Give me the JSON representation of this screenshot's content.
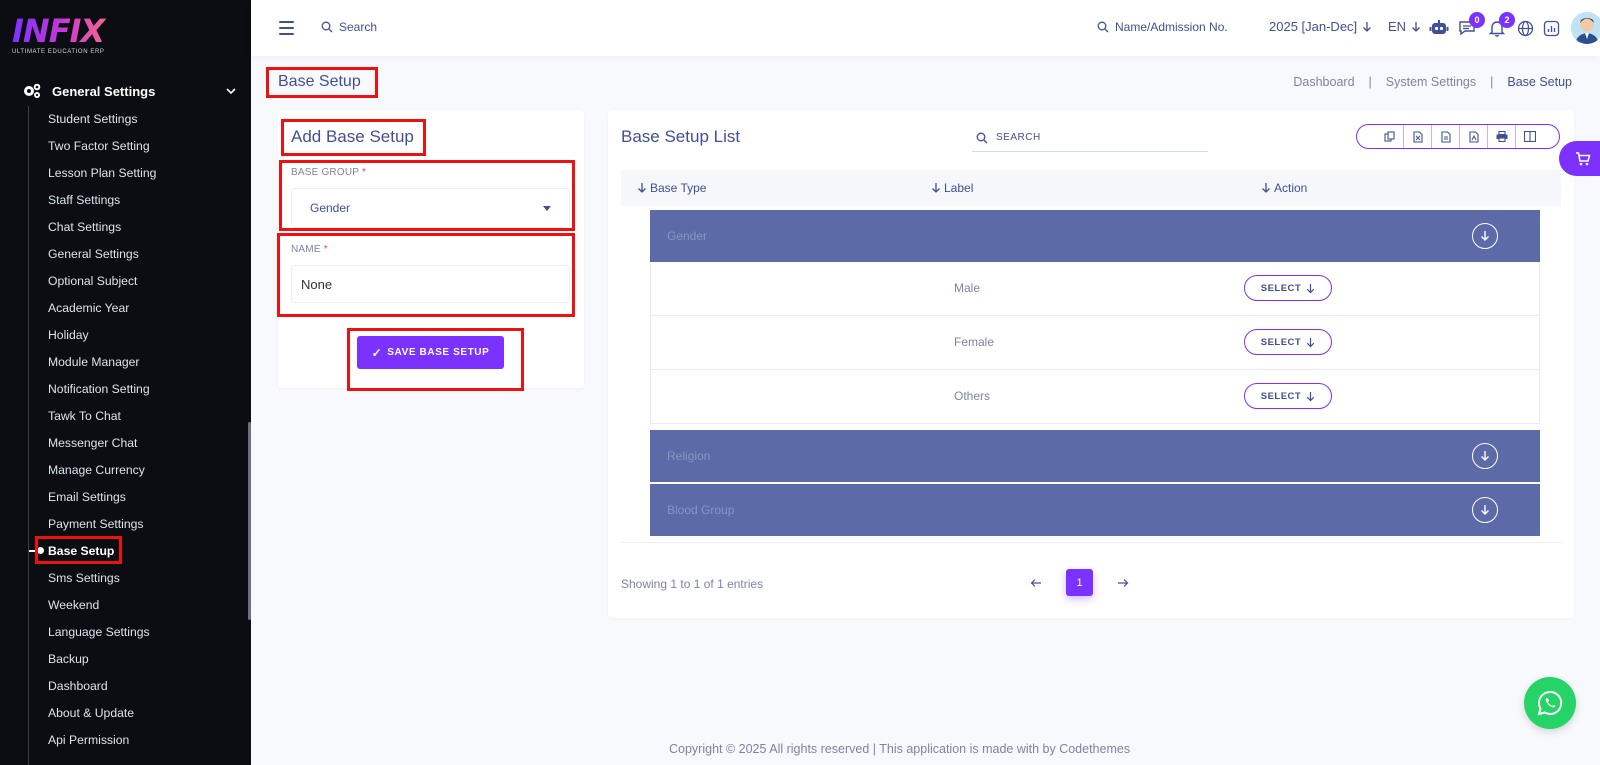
{
  "brand": {
    "logo": "INFIX",
    "tagline": "ULTIMATE EDUCATION ERP"
  },
  "sidebar": {
    "section_title": "General Settings",
    "items": [
      {
        "label": "Student Settings"
      },
      {
        "label": "Two Factor Setting"
      },
      {
        "label": "Lesson Plan Setting"
      },
      {
        "label": "Staff Settings"
      },
      {
        "label": "Chat Settings"
      },
      {
        "label": "General Settings"
      },
      {
        "label": "Optional Subject"
      },
      {
        "label": "Academic Year"
      },
      {
        "label": "Holiday"
      },
      {
        "label": "Module Manager"
      },
      {
        "label": "Notification Setting"
      },
      {
        "label": "Tawk To Chat"
      },
      {
        "label": "Messenger Chat"
      },
      {
        "label": "Manage Currency"
      },
      {
        "label": "Email Settings"
      },
      {
        "label": "Payment Settings"
      },
      {
        "label": "Base Setup",
        "active": true
      },
      {
        "label": "Sms Settings"
      },
      {
        "label": "Weekend"
      },
      {
        "label": "Language Settings"
      },
      {
        "label": "Backup"
      },
      {
        "label": "Dashboard"
      },
      {
        "label": "About & Update"
      },
      {
        "label": "Api Permission"
      }
    ]
  },
  "topbar": {
    "search_placeholder": "Search",
    "admission_search_placeholder": "Name/Admission No.",
    "session": "2025 [Jan-Dec]",
    "language": "EN",
    "messages_count": "0",
    "notifications_count": "2"
  },
  "page": {
    "title": "Base Setup",
    "breadcrumb": [
      "Dashboard",
      "System Settings",
      "Base Setup"
    ]
  },
  "add_form": {
    "title": "Add Base Setup",
    "group_label": "BASE GROUP",
    "group_value": "Gender",
    "name_label": "NAME",
    "required_mark": "*",
    "name_value": "None",
    "save_label": "SAVE BASE SETUP"
  },
  "list": {
    "title": "Base Setup List",
    "search_placeholder": "SEARCH",
    "columns": [
      "Base Type",
      "Label",
      "Action"
    ],
    "groups": [
      {
        "name": "Gender",
        "items": [
          "Male",
          "Female",
          "Others"
        ]
      },
      {
        "name": "Religion",
        "items": []
      },
      {
        "name": "Blood Group",
        "items": []
      }
    ],
    "select_label": "SELECT",
    "entries_text": "Showing 1 to 1 of 1 entries",
    "current_page": "1"
  },
  "footer": {
    "text": "Copyright © 2025 All rights reserved | This application is made with by Codethemes"
  },
  "colors": {
    "accent": "#7c32ff",
    "group_row": "#5d6aa8",
    "text": "#415094",
    "highlight": "#ee1111",
    "whatsapp": "#25d366"
  },
  "icons": [
    "hamburger-icon",
    "search-icon",
    "robot-icon",
    "chat-icon",
    "bell-icon",
    "globe-icon",
    "chart-icon",
    "copy-icon",
    "excel-icon",
    "csv-icon",
    "pdf-icon",
    "print-icon",
    "columns-icon",
    "whatsapp-icon",
    "cart-icon"
  ]
}
